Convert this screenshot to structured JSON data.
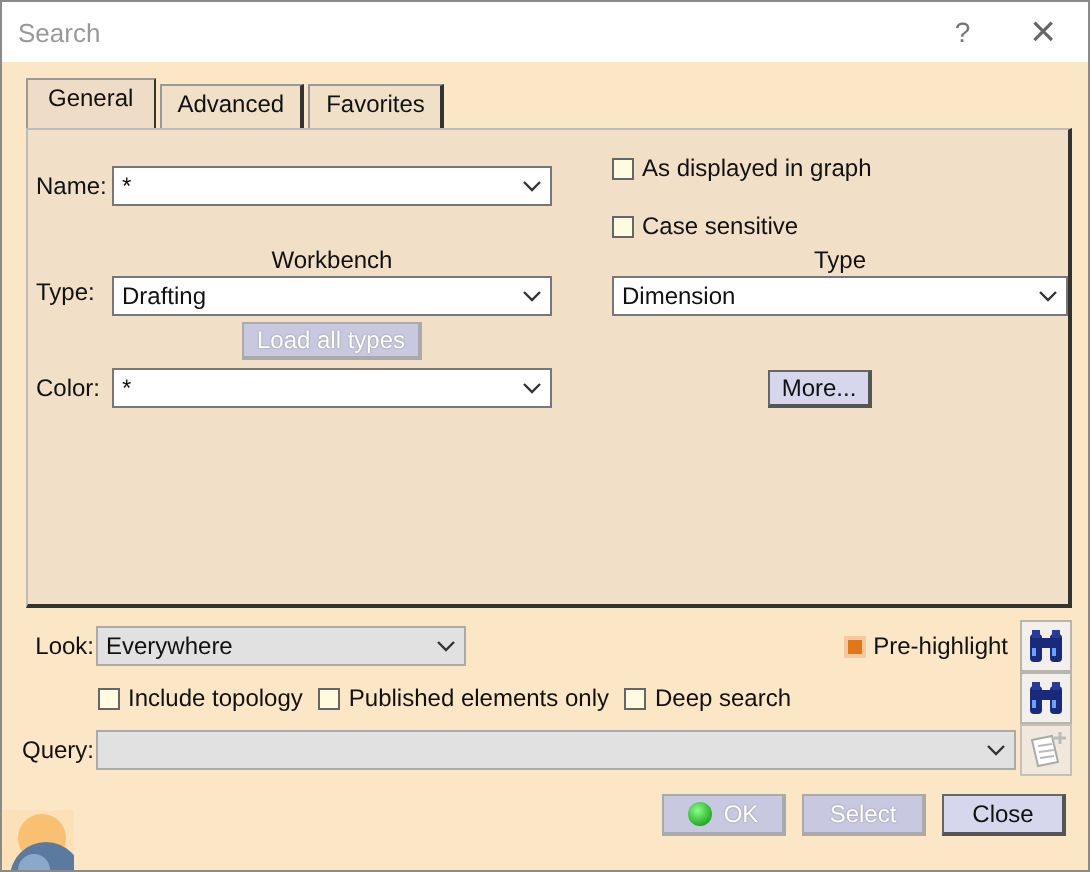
{
  "window": {
    "title": "Search",
    "help": "?",
    "close": "×"
  },
  "tabs": [
    {
      "label": "General",
      "selected": true
    },
    {
      "label": "Advanced",
      "selected": false
    },
    {
      "label": "Favorites",
      "selected": false
    }
  ],
  "general": {
    "name": {
      "label": "Name:",
      "value": "*"
    },
    "workbench_heading": "Workbench",
    "type_heading": "Type",
    "type": {
      "label": "Type:",
      "workbench": "Drafting",
      "value": "Dimension"
    },
    "load_all_types": {
      "label": "Load all types",
      "disabled": true
    },
    "color": {
      "label": "Color:",
      "value": "*"
    },
    "options": [
      {
        "label": "As displayed in graph",
        "checked": false
      },
      {
        "label": "Case sensitive",
        "checked": false
      }
    ],
    "more": {
      "label": "More...",
      "disabled": false
    }
  },
  "look": {
    "label": "Look:",
    "value": "Everywhere"
  },
  "pre_highlight": {
    "label": "Pre-highlight",
    "checked": true
  },
  "filters": [
    {
      "label": "Include topology",
      "checked": false
    },
    {
      "label": "Published elements only",
      "checked": false
    },
    {
      "label": "Deep search",
      "checked": false
    }
  ],
  "query": {
    "label": "Query:",
    "disabled": true
  },
  "buttons": [
    {
      "label": "OK",
      "kind": "ok",
      "disabled": true
    },
    {
      "label": "Select",
      "kind": "plain",
      "disabled": true
    },
    {
      "label": "Close",
      "kind": "plain",
      "disabled": false
    }
  ]
}
